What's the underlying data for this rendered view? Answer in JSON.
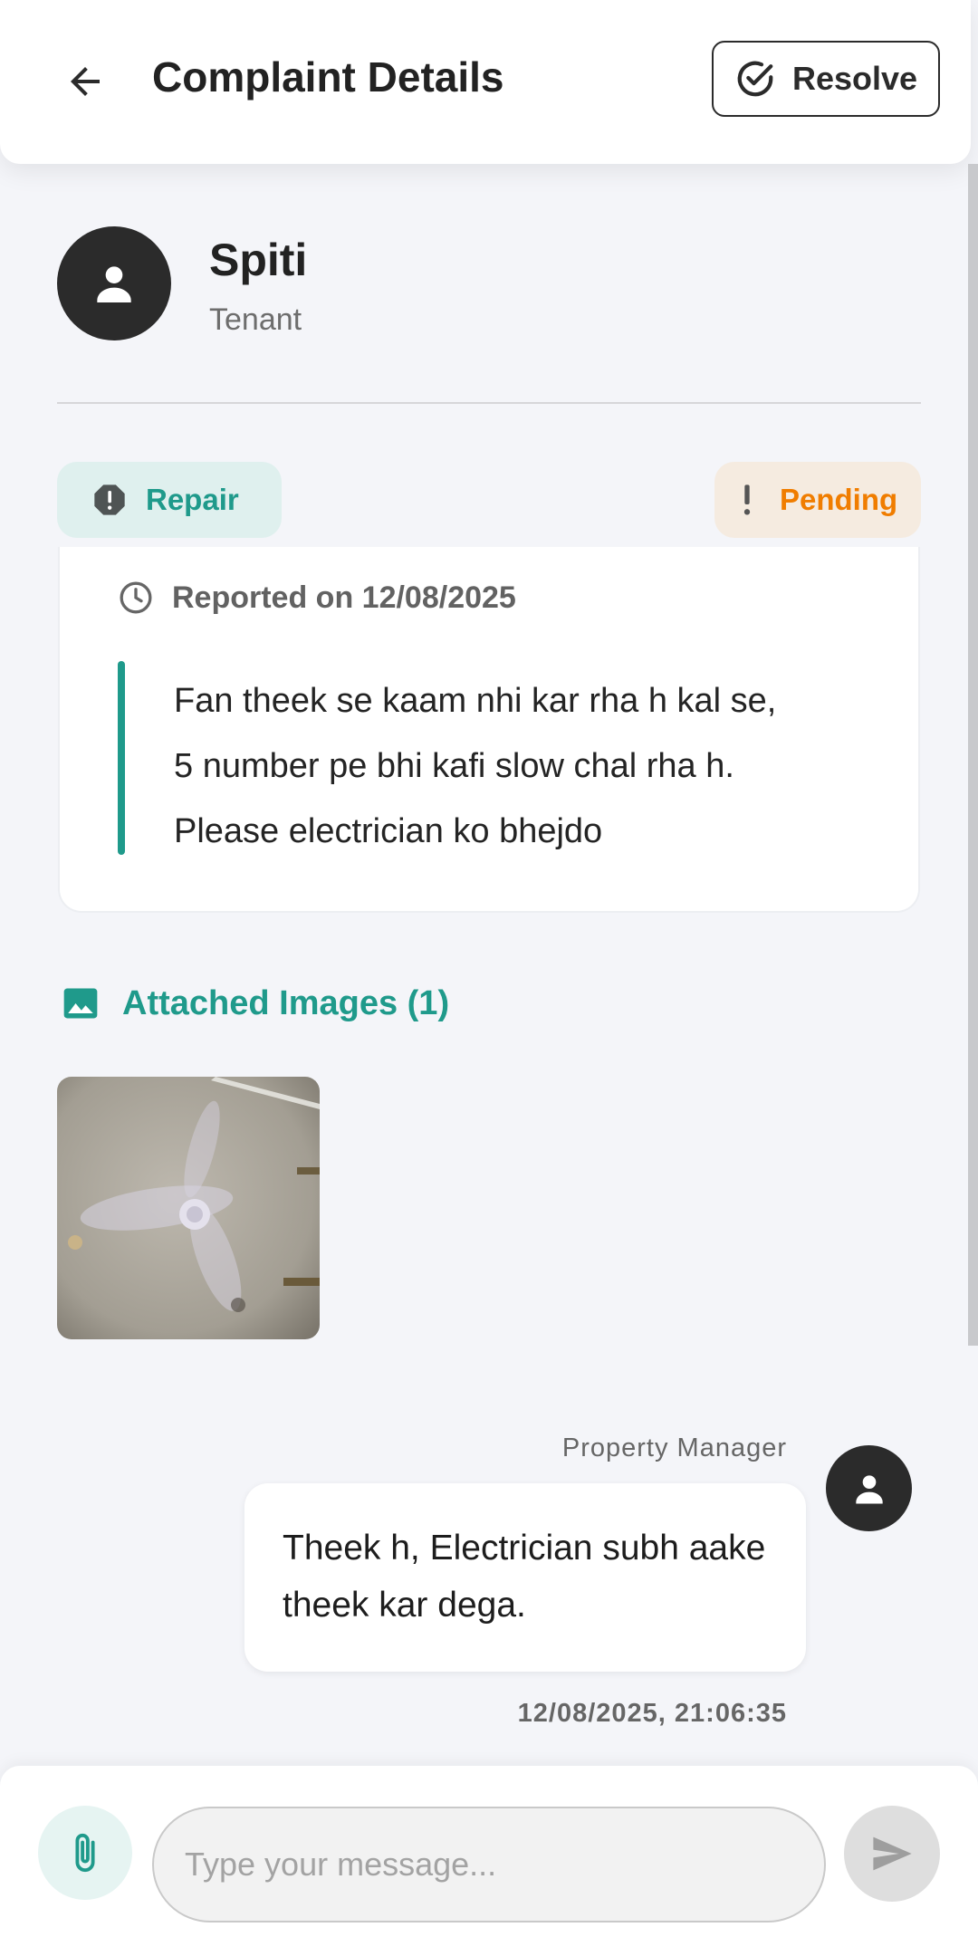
{
  "header": {
    "title": "Complaint Details",
    "back_icon": "arrow-left-icon",
    "resolve_label": "Resolve",
    "resolve_icon": "check-circle-icon"
  },
  "profile": {
    "name": "Spiti",
    "role": "Tenant",
    "avatar_icon": "person-icon"
  },
  "complaint": {
    "category": "Repair",
    "category_icon": "alert-octagon-icon",
    "status": "Pending",
    "status_icon": "exclamation-icon",
    "reported_text": "Reported on 12/08/2025",
    "description_lines": [
      "Fan theek se kaam nhi kar rha h kal se,",
      "5 number pe bhi kafi slow chal rha h.",
      "Please electrician ko bhejdo"
    ]
  },
  "attachments": {
    "heading": "Attached Images (1)",
    "icon": "image-icon",
    "count": 1
  },
  "messages": [
    {
      "sender": "Property Manager",
      "text": "Theek h, Electrician subh aake theek kar dega.",
      "timestamp": "12/08/2025, 21:06:35"
    }
  ],
  "composer": {
    "placeholder": "Type your message...",
    "attach_icon": "paperclip-icon",
    "send_icon": "send-icon"
  },
  "colors": {
    "accent": "#1f9a8b",
    "pending": "#f07d00",
    "background": "#f4f5f9",
    "avatar": "#2b2b2b"
  }
}
